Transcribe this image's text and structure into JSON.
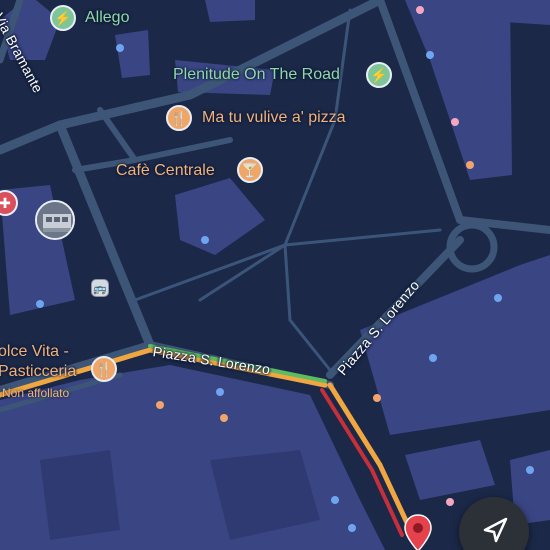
{
  "map": {
    "places": {
      "allego": "Allego",
      "plenitude": "Plenitude On The Road",
      "pizza": "Ma tu vulive a' pizza",
      "cafe": "Cafè Centrale",
      "dolce_line1": "olce Vita -",
      "dolce_line2": "Pasticceria",
      "dolce_sub": "Non affollato"
    },
    "streets": {
      "bramante": "Via Bramante",
      "piazza_horizontal": "Piazza S. Lorenzo",
      "piazza_diagonal": "Piazza S. Lorenzo"
    },
    "icons": {
      "ev_charger": "⚡",
      "restaurant": "🍴",
      "cocktail": "🍸",
      "bus": "🚌",
      "hospital": "✚",
      "navigate": "➤"
    },
    "colors": {
      "background": "#1b2848",
      "building": "#3a4584",
      "road": "#3d5677",
      "route_orange": "#f0a742",
      "route_green": "#5dbb62",
      "route_red": "#c5303a",
      "poi_green": "#8fd9a8",
      "poi_orange": "#f2b27b"
    }
  }
}
